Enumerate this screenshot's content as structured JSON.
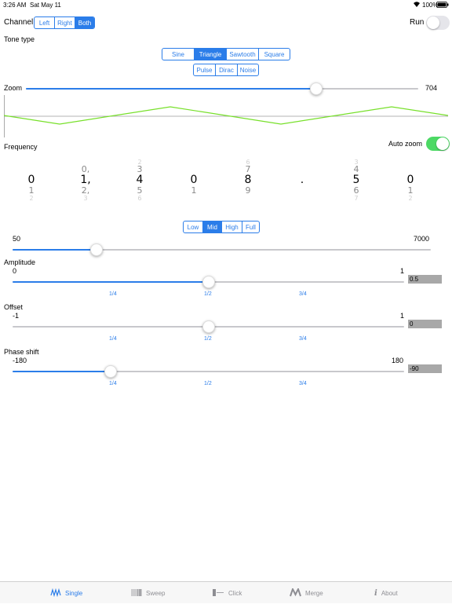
{
  "status": {
    "time": "3:26 AM",
    "date": "Sat May 11",
    "battery": "100%",
    "wifi_icon": "wifi-icon",
    "battery_icon": "battery-icon"
  },
  "channel": {
    "label": "Channel",
    "options": [
      "Left",
      "Right",
      "Both"
    ],
    "selected": "Both"
  },
  "run": {
    "label": "Run",
    "on": false
  },
  "tone_type": {
    "label": "Tone type",
    "row1": [
      "Sine",
      "Triangle",
      "Sawtooth",
      "Square"
    ],
    "row2": [
      "Pulse",
      "Dirac",
      "Noise"
    ],
    "selected": "Triangle"
  },
  "zoom": {
    "label": "Zoom",
    "value": "704",
    "fraction": 0.74
  },
  "frequency": {
    "label": "Frequency",
    "auto_zoom_label": "Auto zoom",
    "auto_zoom_on": true,
    "digits": [
      "0",
      "1,",
      "4",
      "0",
      "8",
      ".",
      "5",
      "0"
    ],
    "above": [
      "",
      "0,",
      "3",
      "",
      "7",
      "",
      "4",
      ""
    ],
    "above2": [
      "",
      "",
      "2",
      "",
      "6",
      "",
      "3",
      ""
    ],
    "below": [
      "1",
      "2,",
      "5",
      "1",
      "9",
      "",
      "6",
      "1"
    ],
    "below2": [
      "2",
      "3",
      "6",
      "",
      "",
      "",
      "7",
      "2"
    ]
  },
  "range": {
    "options": [
      "Low",
      "Mid",
      "High",
      "Full"
    ],
    "selected": "Mid",
    "min": "50",
    "max": "7000",
    "fraction": 0.2
  },
  "amplitude": {
    "label": "Amplitude",
    "min": "0",
    "max": "1",
    "value": "0.5",
    "fraction": 0.5
  },
  "offset": {
    "label": "Offset",
    "min": "-1",
    "max": "1",
    "value": "0",
    "fraction": 0.5
  },
  "phase": {
    "label": "Phase shift",
    "min": "-180",
    "max": "180",
    "value": "-90",
    "fraction": 0.25
  },
  "fractions": [
    "1/4",
    "1/2",
    "3/4"
  ],
  "tabs": [
    {
      "label": "Single",
      "icon": "waveform-icon",
      "active": true
    },
    {
      "label": "Sweep",
      "icon": "sweep-icon",
      "active": false
    },
    {
      "label": "Click",
      "icon": "click-icon",
      "active": false
    },
    {
      "label": "Merge",
      "icon": "merge-icon",
      "active": false
    },
    {
      "label": "About",
      "icon": "info-icon",
      "active": false
    }
  ],
  "colors": {
    "accent": "#2b7de9",
    "wave": "#77e02a",
    "switch_on": "#4cd964"
  }
}
